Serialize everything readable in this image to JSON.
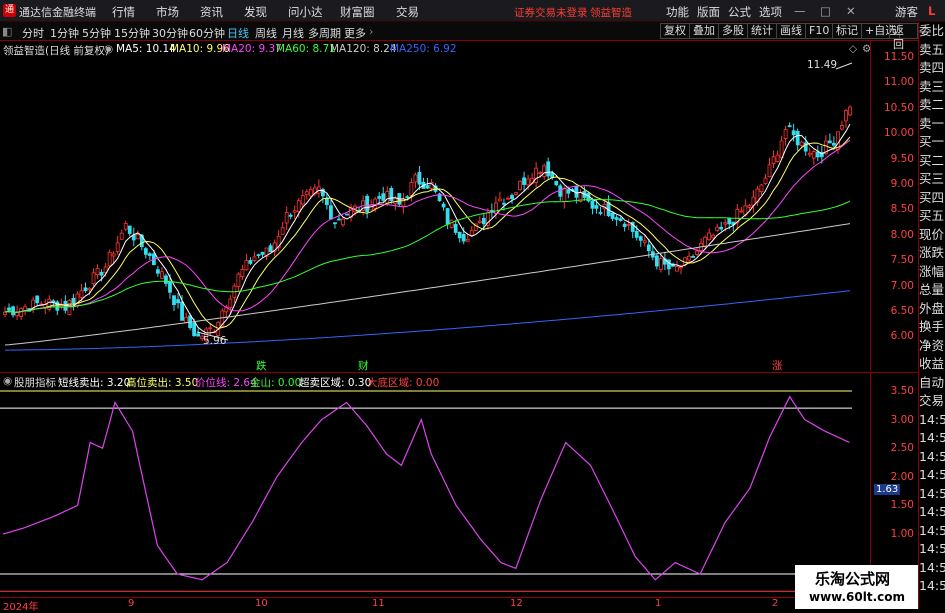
{
  "app": {
    "title": "通达信金融终端",
    "logo": "logo-icon"
  },
  "menu": {
    "items": [
      "行情",
      "市场",
      "资讯",
      "发现",
      "问小达",
      "财富圈",
      "交易"
    ],
    "status_warn": "证券交易未登录",
    "stock": "领益智造",
    "right_items": [
      "功能",
      "版面",
      "公式",
      "选项"
    ],
    "guest": "游客",
    "l_badge": "L"
  },
  "toolbar": {
    "periods": [
      "分时",
      "1分钟",
      "5分钟",
      "15分钟",
      "30分钟",
      "60分钟",
      "日线",
      "周线",
      "月线",
      "多周期",
      "更多"
    ],
    "active_period": "日线",
    "buttons": [
      "复权",
      "叠加",
      "多股",
      "统计",
      "画线",
      "F10",
      "标记",
      "+自选",
      "返回"
    ]
  },
  "main_legend": {
    "title": "领益智造(日线 前复权)",
    "ma": [
      {
        "label": "MA5: 10.14",
        "color": "#ffffff"
      },
      {
        "label": "MA10: 9.96",
        "color": "#ffff66"
      },
      {
        "label": "MA20: 9.37",
        "color": "#ff44ff"
      },
      {
        "label": "MA60: 8.71",
        "color": "#33ff33"
      },
      {
        "label": "MA120: 8.24",
        "color": "#cccccc"
      },
      {
        "label": "MA250: 6.92",
        "color": "#3366ff"
      }
    ]
  },
  "price_axis": [
    "11.50",
    "11.00",
    "10.50",
    "10.00",
    "9.50",
    "9.00",
    "8.50",
    "8.00",
    "7.50",
    "7.00",
    "6.50",
    "6.00"
  ],
  "annotations": {
    "high": "11.49",
    "low": "5.96",
    "events": [
      "跌",
      "财",
      "涨"
    ]
  },
  "indicator": {
    "name": "股朋指标",
    "items": [
      {
        "label": "短线卖出: 3.20",
        "color": "#ffffff"
      },
      {
        "label": "高位卖出: 3.50",
        "color": "#ffff66"
      },
      {
        "label": "价位线: 2.64",
        "color": "#ff44ff"
      },
      {
        "label": "金山: 0.00",
        "color": "#33ff33"
      },
      {
        "label": "超卖区域: 0.30",
        "color": "#ffffff"
      },
      {
        "label": "大底区域: 0.00",
        "color": "#ff4040"
      }
    ],
    "axis": [
      "3.50",
      "3.00",
      "2.50",
      "2.00",
      "1.50",
      "1.00"
    ],
    "current": "1.63"
  },
  "x_axis": [
    "2024年",
    "9",
    "10",
    "11",
    "12",
    "1",
    "2"
  ],
  "right_strip": [
    "委比",
    "卖五",
    "卖四",
    "卖三",
    "卖二",
    "卖一",
    "买一",
    "买二",
    "买三",
    "买四",
    "买五",
    "现价",
    "涨跌",
    "涨幅",
    "总量",
    "外盘",
    "换手",
    "净资",
    "收益",
    "自动",
    "交易",
    "14:56",
    "14:56",
    "14:56",
    "14:56",
    "14:56",
    "14:56",
    "14:56",
    "14:56",
    "14:56",
    "14:56"
  ],
  "watermark": {
    "line1": "乐淘公式网",
    "line2": "www.60lt.com"
  }
}
